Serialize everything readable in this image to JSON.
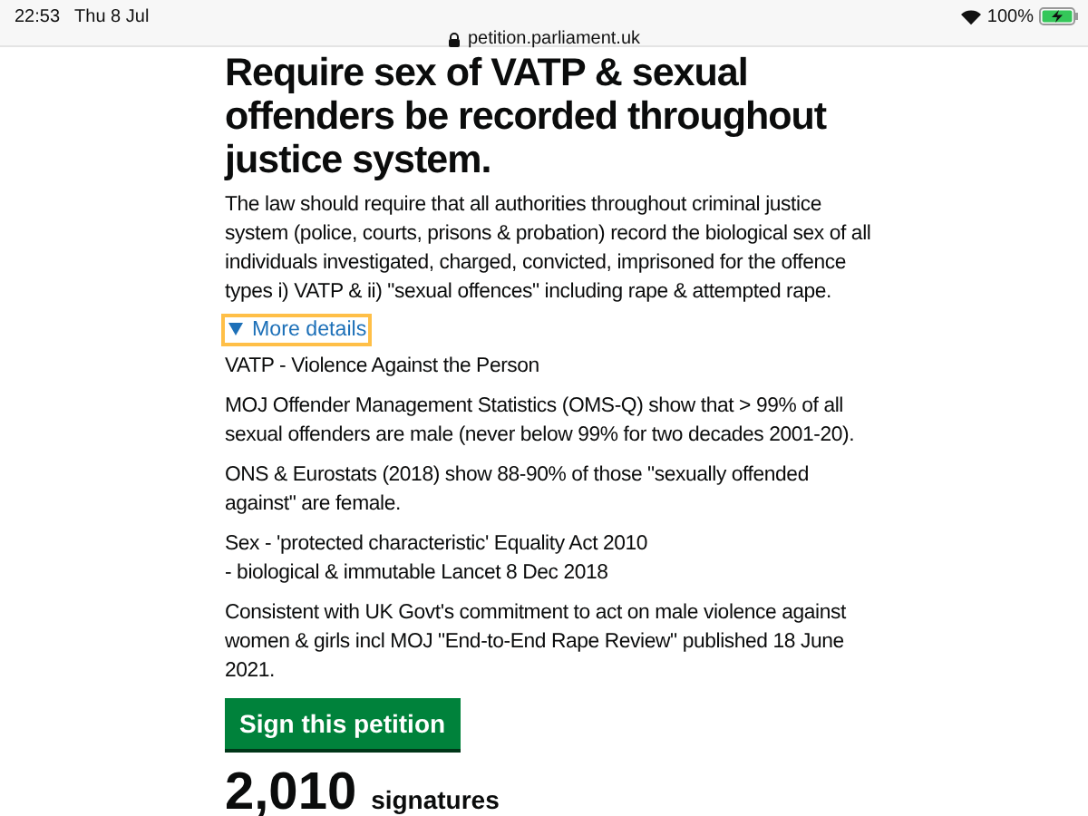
{
  "status_bar": {
    "time": "22:53",
    "date": "Thu 8 Jul",
    "url": "petition.parliament.uk",
    "battery": "100%",
    "charging": true
  },
  "petition": {
    "title": "Require sex of VATP & sexual offenders be recorded throughout justice system.",
    "summary": "The law should require that all authorities throughout criminal justice system (police, courts, prisons & probation) record the biological sex of all individuals investigated, charged, convicted, imprisoned for the offence types i) VATP & ii) \"sexual offences\" including rape & attempted rape.",
    "details": {
      "label": "More details",
      "expanded": true,
      "paragraphs": [
        "VATP - Violence Against the Person",
        "MOJ Offender Management Statistics (OMS-Q) show that > 99% of all sexual offenders are male (never below 99% for two decades 2001-20).",
        "ONS & Eurostats (2018) show 88-90% of those \"sexually offended against\" are female.",
        "Sex - 'protected characteristic' Equality Act 2010\n- biological & immutable Lancet 8 Dec 2018",
        "Consistent with UK Govt's commitment to act on male violence against women & girls incl MOJ \"End-to-End Rape Review\" published 18 June 2021."
      ]
    },
    "sign_button": "Sign this petition",
    "signature_count": "2,010",
    "signature_label": "signatures"
  }
}
